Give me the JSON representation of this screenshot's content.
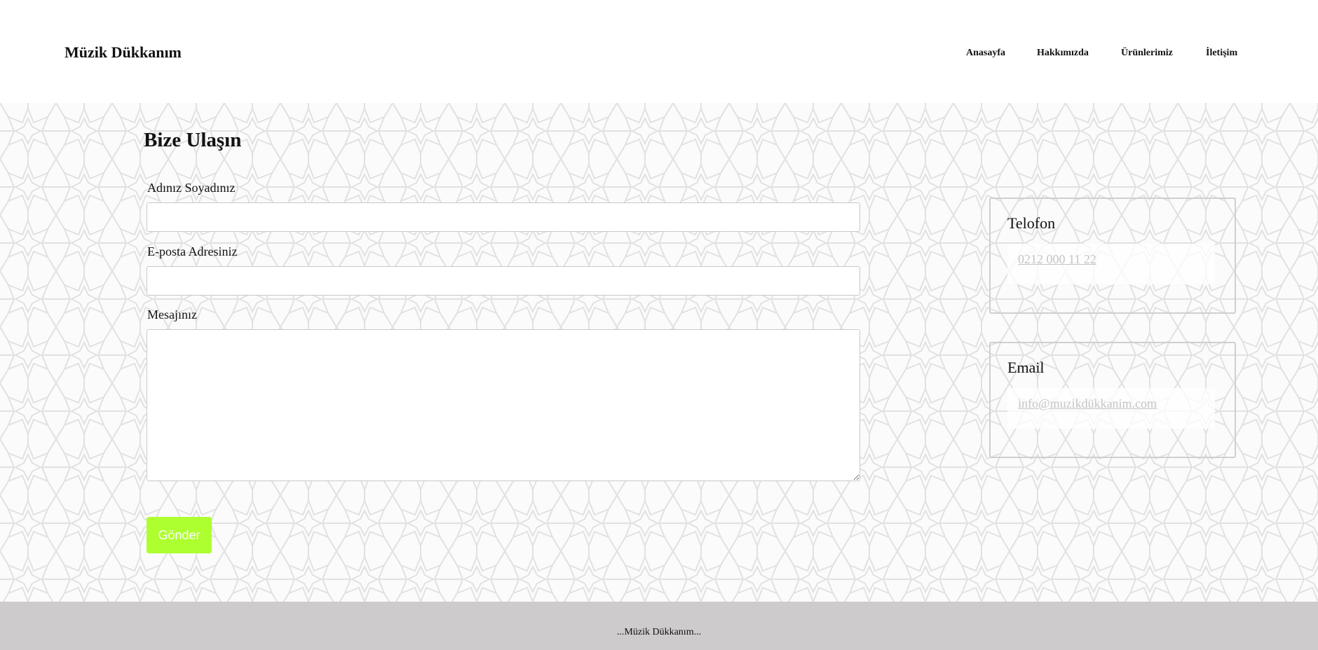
{
  "header": {
    "brand": "Müzik Dükkanım",
    "nav": [
      "Anasayfa",
      "Hakkımızda",
      "Ürünlerimiz",
      "İletişim"
    ]
  },
  "contact": {
    "title": "Bize Ulaşın",
    "name_label": "Adınız Soyadınız",
    "name_value": "",
    "email_label": "E-posta Adresiniz",
    "email_value": "",
    "message_label": "Mesajınız",
    "message_value": "",
    "submit_label": "Gönder"
  },
  "info": {
    "phone_title": "Telofon",
    "phone_value": "0212 000 11 22",
    "email_title": "Email",
    "email_value": "info@muzikdükkanim.com"
  },
  "footer": {
    "text": "...Müzik Dükkanım..."
  },
  "colors": {
    "accent_button": "#adff2f",
    "footer_bg": "#cdcbcc",
    "link_muted": "#c4c4c4"
  }
}
